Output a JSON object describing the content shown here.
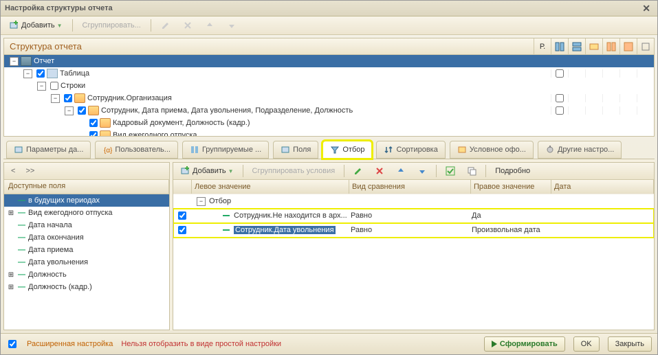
{
  "title": "Настройка структуры отчета",
  "toolbar": {
    "add": "Добавить",
    "group": "Сгруппировать..."
  },
  "structure": {
    "title": "Структура отчета",
    "colR": "Р.",
    "rows": [
      {
        "indent": 0,
        "exp": "-",
        "cb": false,
        "iconType": "report",
        "label": "Отчет",
        "selected": true,
        "r": false
      },
      {
        "indent": 1,
        "exp": "-",
        "cb": true,
        "iconType": "table",
        "label": "Таблица",
        "r": true
      },
      {
        "indent": 2,
        "exp": "-",
        "cb": false,
        "iconType": "",
        "label": "Строки",
        "r": false
      },
      {
        "indent": 3,
        "exp": "-",
        "cb": true,
        "iconType": "group",
        "label": "Сотрудник.Организация",
        "r": true
      },
      {
        "indent": 4,
        "exp": "-",
        "cb": true,
        "iconType": "group",
        "label": "Сотрудник, Дата приема, Дата увольнения, Подразделение, Должность",
        "r": true
      },
      {
        "indent": 5,
        "exp": "",
        "cb": true,
        "iconType": "group",
        "label": "Кадровый документ, Должность (кадр.)",
        "r": false
      },
      {
        "indent": 5,
        "exp": "",
        "cb": true,
        "iconType": "group",
        "label": "Вид ежегодного отпуска",
        "r": false
      }
    ]
  },
  "tabs": [
    {
      "label": "Параметры да...",
      "icon": "params"
    },
    {
      "label": "Пользователь...",
      "icon": "user"
    },
    {
      "label": "Группируемые ...",
      "icon": "group"
    },
    {
      "label": "Поля",
      "icon": "fields"
    },
    {
      "label": "Отбор",
      "icon": "filter",
      "active": true,
      "hl": true
    },
    {
      "label": "Сортировка",
      "icon": "sort"
    },
    {
      "label": "Условное офо...",
      "icon": "cond"
    },
    {
      "label": "Другие настро...",
      "icon": "other"
    }
  ],
  "available": {
    "title": "Доступные поля",
    "nav_back": "<",
    "nav_fwd": ">>",
    "items": [
      {
        "label": "в будущих периодах",
        "selected": true,
        "exp": ""
      },
      {
        "label": "Вид ежегодного отпуска",
        "exp": "+"
      },
      {
        "label": "Дата начала",
        "exp": ""
      },
      {
        "label": "Дата окончания",
        "exp": ""
      },
      {
        "label": "Дата приема",
        "exp": ""
      },
      {
        "label": "Дата увольнения",
        "exp": ""
      },
      {
        "label": "Должность",
        "exp": "+"
      },
      {
        "label": "Должность (кадр.)",
        "exp": "+"
      }
    ]
  },
  "filter": {
    "toolbar": {
      "add": "Добавить",
      "group": "Сгруппировать условия",
      "detail": "Подробно"
    },
    "cols": {
      "left": "Левое значение",
      "cmp": "Вид сравнения",
      "right": "Правое значение",
      "date": "Дата"
    },
    "parent": "Отбор",
    "rows": [
      {
        "checked": true,
        "left": "Сотрудник.Не находится в арх...",
        "cmp": "Равно",
        "right": "Да",
        "hl": true
      },
      {
        "checked": true,
        "left": "Сотрудник.Дата увольнения",
        "leftSel": true,
        "cmp": "Равно",
        "right": "Произвольная дата",
        "hl": true
      }
    ]
  },
  "footer": {
    "adv": "Расширенная настройка",
    "warn": "Нельзя отобразить в виде простой настройки",
    "form": "Сформировать",
    "ok": "OK",
    "close": "Закрыть"
  }
}
